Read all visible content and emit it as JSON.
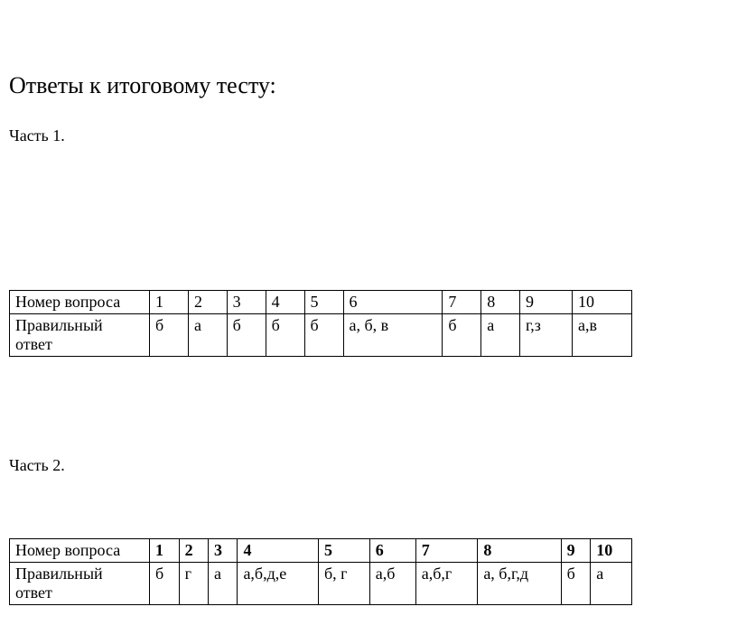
{
  "title": "Ответы к итоговому тесту:",
  "part1": {
    "label": "Часть 1.",
    "row_label_1": "Номер вопроса",
    "row_label_2": "Правильный ответ",
    "numbers": [
      "1",
      "2",
      "3",
      "4",
      "5",
      "6",
      "7",
      "8",
      "9",
      "10"
    ],
    "answers": [
      "б",
      "а",
      "б",
      "б",
      "б",
      "а, б, в",
      "б",
      "а",
      "г,з",
      "а,в"
    ]
  },
  "part2": {
    "label": "Часть 2.",
    "row_label_1": "Номер вопроса",
    "row_label_2": "Правильный ответ",
    "numbers": [
      "1",
      "2",
      "3",
      "4",
      "5",
      "6",
      "7",
      "8",
      "9",
      "10"
    ],
    "answers": [
      "б",
      "г",
      "а",
      "а,б,д,е",
      "б, г",
      "а,б",
      "а,б,г",
      "а, б,г,д",
      "б",
      "а"
    ]
  }
}
